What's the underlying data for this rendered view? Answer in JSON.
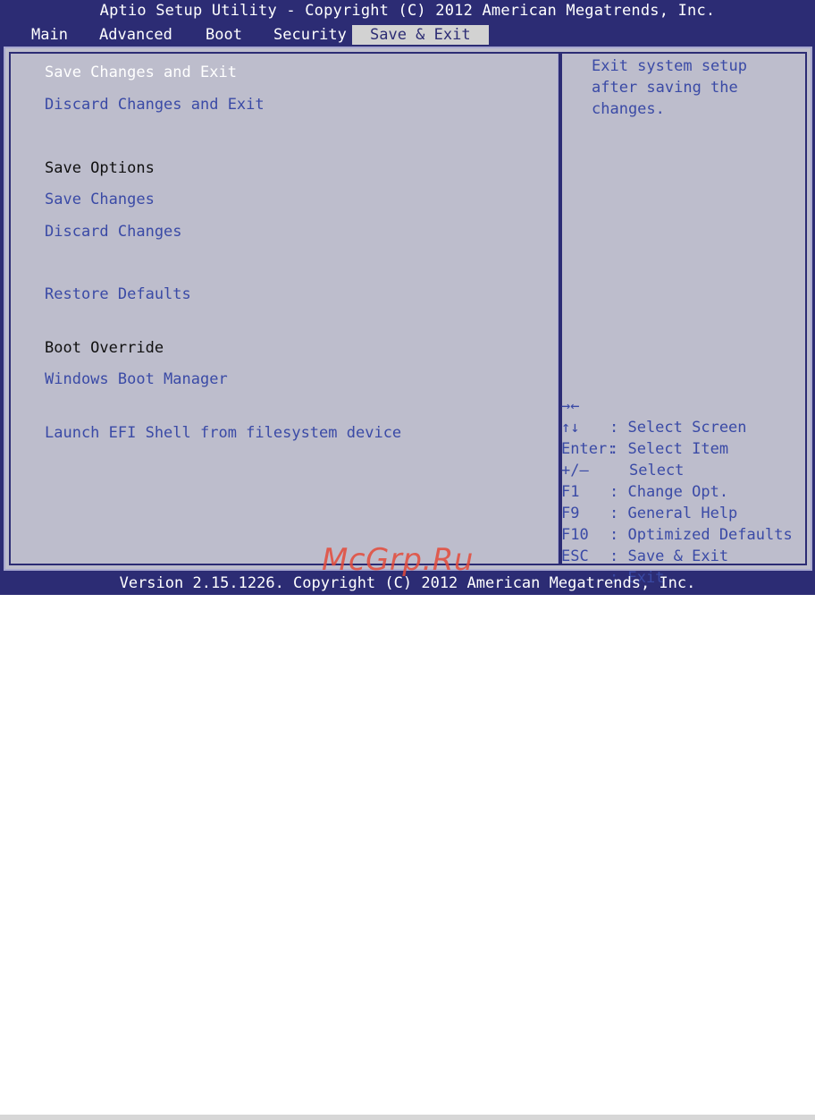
{
  "header": {
    "title": "Aptio Setup Utility - Copyright (C) 2012 American Megatrends, Inc."
  },
  "tabs": [
    {
      "label": "Main",
      "active": false
    },
    {
      "label": "Advanced",
      "active": false
    },
    {
      "label": "Boot",
      "active": false
    },
    {
      "label": "Security",
      "active": false
    },
    {
      "label": "Save & Exit",
      "active": true
    }
  ],
  "menu": {
    "save_changes_and_exit": "Save Changes and Exit",
    "discard_changes_and_exit": "Discard Changes and Exit",
    "save_options_header": "Save Options",
    "save_changes": "Save Changes",
    "discard_changes": "Discard Changes",
    "restore_defaults": "Restore Defaults",
    "boot_override_header": "Boot Override",
    "windows_boot_manager": "Windows Boot Manager",
    "launch_efi_shell": "Launch EFI Shell from filesystem device"
  },
  "help": {
    "text": "Exit system setup\nafter saving the\nchanges."
  },
  "keys": [
    {
      "key": "→←",
      "desc": ": Select Screen"
    },
    {
      "key": "↑↓",
      "desc": ": Select Item"
    },
    {
      "key": "Enter:",
      "desc": "Select"
    },
    {
      "key": "+/—",
      "desc": ": Change Opt."
    },
    {
      "key": "F1",
      "desc": ": General Help"
    },
    {
      "key": "F9",
      "desc": ": Optimized Defaults"
    },
    {
      "key": "F10",
      "desc": ": Save & Exit"
    },
    {
      "key": "ESC",
      "desc": ": Exit"
    }
  ],
  "footer": {
    "text": "Version 2.15.1226. Copyright (C) 2012 American Megatrends, Inc."
  },
  "watermark": "McGrp.Ru",
  "colors": {
    "background": "#2c2c74",
    "panel": "#bdbdcc",
    "link": "#3a4aa6",
    "selected": "#ffffff",
    "watermark": "#e44a3a"
  }
}
